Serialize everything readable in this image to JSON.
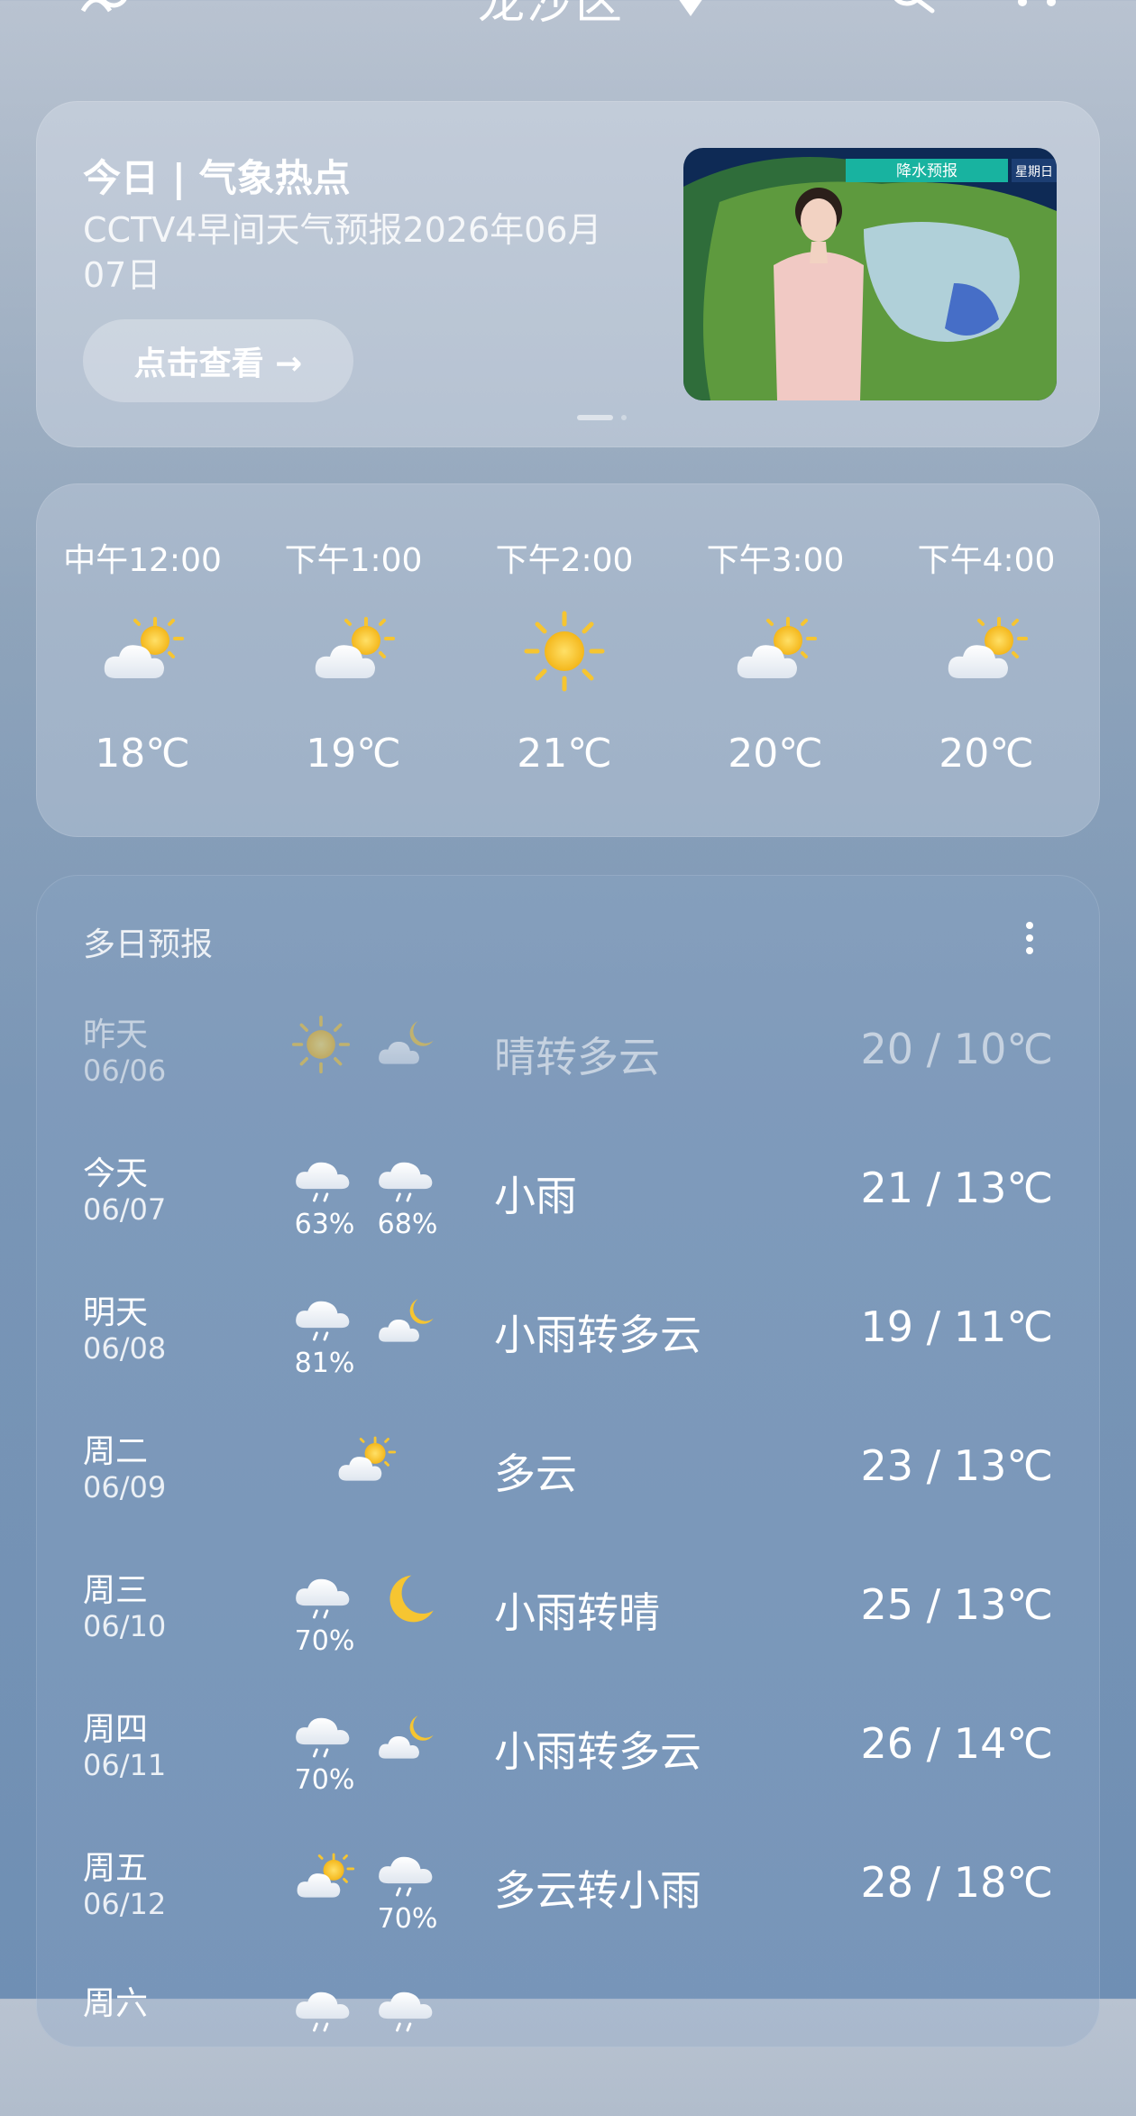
{
  "header": {
    "city": "龙沙区"
  },
  "hot": {
    "title": "今日 | 气象热点",
    "subtitle": "CCTV4早间天气预报2026年06月07日",
    "button": "点击查看 →",
    "thumb_label": "降水预报",
    "thumb_corner": "星期日"
  },
  "hourly": [
    {
      "time": "中午12:00",
      "icon": "partly-cloudy-icon",
      "temp": "18℃"
    },
    {
      "time": "下午1:00",
      "icon": "partly-cloudy-icon",
      "temp": "19℃"
    },
    {
      "time": "下午2:00",
      "icon": "sun-icon",
      "temp": "21℃"
    },
    {
      "time": "下午3:00",
      "icon": "partly-cloudy-icon",
      "temp": "20℃"
    },
    {
      "time": "下午4:00",
      "icon": "partly-cloudy-icon",
      "temp": "20℃"
    }
  ],
  "daily": {
    "title": "多日预报",
    "rows": [
      {
        "day": "昨天",
        "date": "06/06",
        "day_icon": "sun-icon",
        "night_icon": "cloudy-moon-icon",
        "day_pct": "",
        "night_pct": "",
        "desc": "晴转多云",
        "temps": "20 / 10℃"
      },
      {
        "day": "今天",
        "date": "06/07",
        "day_icon": "light-rain-icon",
        "night_icon": "light-rain-icon",
        "day_pct": "63%",
        "night_pct": "68%",
        "desc": "小雨",
        "temps": "21 / 13℃"
      },
      {
        "day": "明天",
        "date": "06/08",
        "day_icon": "light-rain-icon",
        "night_icon": "cloudy-moon-icon",
        "day_pct": "81%",
        "night_pct": "",
        "desc": "小雨转多云",
        "temps": "19 / 11℃"
      },
      {
        "day": "周二",
        "date": "06/09",
        "day_icon": "partly-cloudy-icon",
        "night_icon": "",
        "day_pct": "",
        "night_pct": "",
        "desc": "多云",
        "temps": "23 / 13℃"
      },
      {
        "day": "周三",
        "date": "06/10",
        "day_icon": "light-rain-icon",
        "night_icon": "moon-icon",
        "day_pct": "70%",
        "night_pct": "",
        "desc": "小雨转晴",
        "temps": "25 / 13℃"
      },
      {
        "day": "周四",
        "date": "06/11",
        "day_icon": "light-rain-icon",
        "night_icon": "cloudy-moon-icon",
        "day_pct": "70%",
        "night_pct": "",
        "desc": "小雨转多云",
        "temps": "26 / 14℃"
      },
      {
        "day": "周五",
        "date": "06/12",
        "day_icon": "partly-cloudy-icon",
        "night_icon": "light-rain-icon",
        "day_pct": "",
        "night_pct": "70%",
        "desc": "多云转小雨",
        "temps": "28 / 18℃"
      },
      {
        "day": "周六",
        "date": "",
        "day_icon": "light-rain-icon",
        "night_icon": "light-rain-icon",
        "day_pct": "",
        "night_pct": "",
        "desc": "",
        "temps": ""
      }
    ]
  },
  "colors": {
    "sun": "#f6c531",
    "cloud": "#f4f6f9",
    "rain": "#ffffff"
  }
}
